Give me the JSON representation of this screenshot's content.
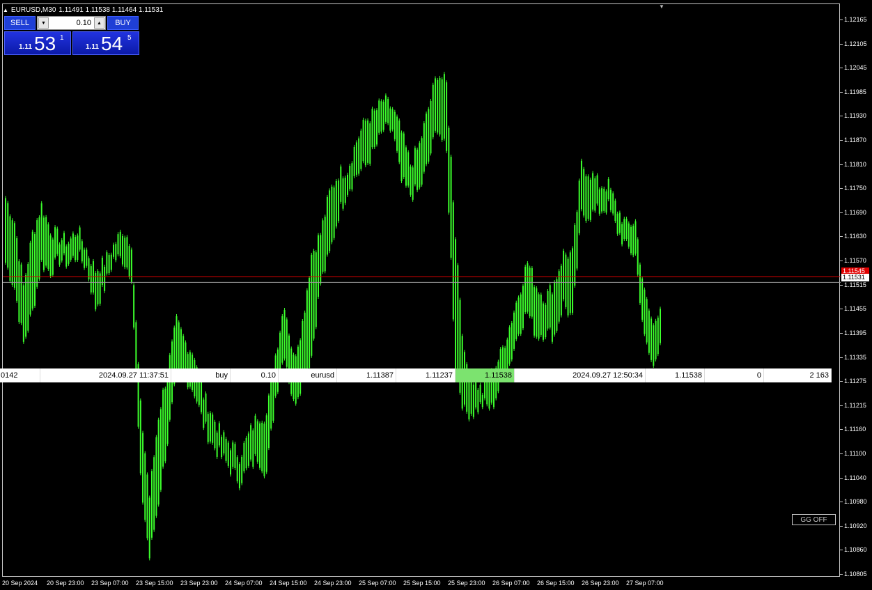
{
  "header": {
    "symbol": "EURUSD,M30",
    "ohlc": "1.11491 1.11538 1.11464 1.11531"
  },
  "trading_panel": {
    "sell_label": "SELL",
    "buy_label": "BUY",
    "lot": "0.10",
    "sell_price": {
      "prefix": "1.11",
      "big": "53",
      "sup": "1"
    },
    "buy_price": {
      "prefix": "1.11",
      "big": "54",
      "sup": "5"
    }
  },
  "price_axis": {
    "labels": [
      "1.12165",
      "1.12105",
      "1.12045",
      "1.11985",
      "1.11930",
      "1.11870",
      "1.11810",
      "1.11750",
      "1.11690",
      "1.11630",
      "1.11570",
      "1.11515",
      "1.11455",
      "1.11395",
      "1.11335",
      "1.11275",
      "1.11215",
      "1.11160",
      "1.11100",
      "1.11040",
      "1.10980",
      "1.10920",
      "1.10860",
      "1.10805"
    ],
    "ask_tag": "1.11545",
    "bid_tag": "1.11531"
  },
  "time_axis": {
    "labels": [
      "20 Sep 2024",
      "20 Sep 23:00",
      "23 Sep 07:00",
      "23 Sep 15:00",
      "23 Sep 23:00",
      "24 Sep 07:00",
      "24 Sep 15:00",
      "24 Sep 23:00",
      "25 Sep 07:00",
      "25 Sep 15:00",
      "25 Sep 23:00",
      "26 Sep 07:00",
      "26 Sep 15:00",
      "26 Sep 23:00",
      "27 Sep 07:00"
    ]
  },
  "trade": {
    "ticket": "0142",
    "open_time": "2024.09.27 11:37:51",
    "type": "buy",
    "volume": "0.10",
    "symbol": "eurusd",
    "open_price": "1.11387",
    "sl": "1.11237",
    "current": "1.11538",
    "close_time": "2024.09.27 12:50:34",
    "price2": "1.11538",
    "swap": "0",
    "profit": "2 163"
  },
  "gg_button": "GG  OFF",
  "colors": {
    "candles": "#3cff2c",
    "ask_line": "#e00000",
    "bid_line": "#9a9a9a",
    "current_cell": "#7ce36f"
  },
  "chart_data": {
    "type": "candlestick",
    "symbol": "EURUSD",
    "timeframe": "M30",
    "ylim": [
      1.108,
      1.1222
    ],
    "bid": 1.11531,
    "ask": 1.11545,
    "path": [
      [
        1.1174,
        1.1158
      ],
      [
        1.1168,
        1.1152
      ],
      [
        1.1152,
        1.1138
      ],
      [
        1.1165,
        1.1146
      ],
      [
        1.1172,
        1.1158
      ],
      [
        1.1166,
        1.1156
      ],
      [
        1.1164,
        1.1159
      ],
      [
        1.1163,
        1.1158
      ],
      [
        1.1166,
        1.116
      ],
      [
        1.1161,
        1.1157
      ],
      [
        1.1156,
        1.1147
      ],
      [
        1.1158,
        1.1152
      ],
      [
        1.1162,
        1.1159
      ],
      [
        1.1166,
        1.1159
      ],
      [
        1.1163,
        1.1155
      ],
      [
        1.1122,
        1.1104
      ],
      [
        1.11,
        1.1085
      ],
      [
        1.112,
        1.1099
      ],
      [
        1.1131,
        1.1114
      ],
      [
        1.1143,
        1.113
      ],
      [
        1.1138,
        1.113
      ],
      [
        1.1135,
        1.1126
      ],
      [
        1.1125,
        1.1118
      ],
      [
        1.112,
        1.1113
      ],
      [
        1.1115,
        1.111
      ],
      [
        1.1113,
        1.1107
      ],
      [
        1.111,
        1.1104
      ],
      [
        1.1115,
        1.1107
      ],
      [
        1.112,
        1.111
      ],
      [
        1.112,
        1.1106
      ],
      [
        1.1135,
        1.1125
      ],
      [
        1.1148,
        1.1136
      ],
      [
        1.1134,
        1.1123
      ],
      [
        1.1143,
        1.1129
      ],
      [
        1.116,
        1.1135
      ],
      [
        1.1165,
        1.1153
      ],
      [
        1.1175,
        1.116
      ],
      [
        1.118,
        1.117
      ],
      [
        1.1181,
        1.1176
      ],
      [
        1.1188,
        1.118
      ],
      [
        1.1193,
        1.1182
      ],
      [
        1.1195,
        1.1186
      ],
      [
        1.1198,
        1.1191
      ],
      [
        1.1196,
        1.1191
      ],
      [
        1.119,
        1.1178
      ],
      [
        1.1182,
        1.1175
      ],
      [
        1.1187,
        1.1176
      ],
      [
        1.1196,
        1.1183
      ],
      [
        1.1205,
        1.1192
      ],
      [
        1.1202,
        1.1185
      ],
      [
        1.1165,
        1.1132
      ],
      [
        1.1134,
        1.1121
      ],
      [
        1.1129,
        1.1121
      ],
      [
        1.1126,
        1.1123
      ],
      [
        1.113,
        1.1122
      ],
      [
        1.1135,
        1.1128
      ],
      [
        1.1142,
        1.1133
      ],
      [
        1.115,
        1.1141
      ],
      [
        1.1158,
        1.1146
      ],
      [
        1.1152,
        1.114
      ],
      [
        1.1149,
        1.1141
      ],
      [
        1.1153,
        1.114
      ],
      [
        1.116,
        1.1148
      ],
      [
        1.116,
        1.1144
      ],
      [
        1.1182,
        1.117
      ],
      [
        1.118,
        1.117
      ],
      [
        1.1177,
        1.1171
      ],
      [
        1.1177,
        1.1172
      ],
      [
        1.1171,
        1.1166
      ],
      [
        1.1167,
        1.1162
      ],
      [
        1.1168,
        1.116
      ],
      [
        1.115,
        1.1139
      ],
      [
        1.1142,
        1.1132
      ],
      [
        1.115,
        1.1142
      ]
    ]
  }
}
